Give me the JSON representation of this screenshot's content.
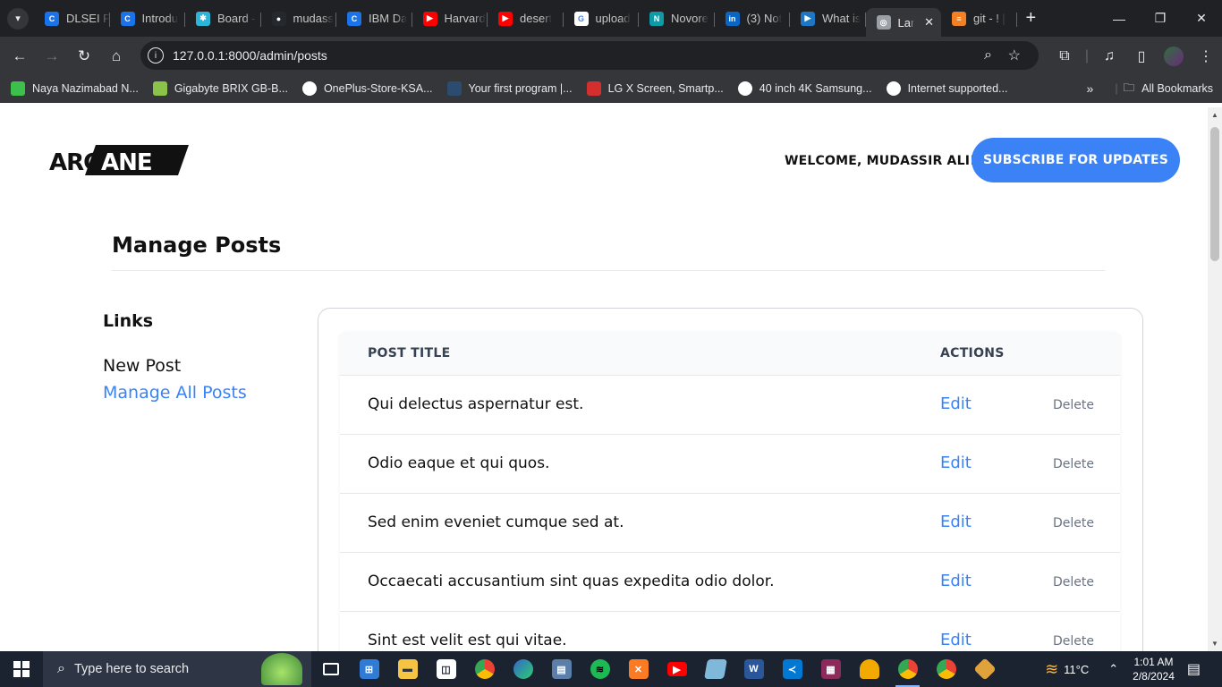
{
  "browser": {
    "tabs": [
      {
        "title": "DLSEI P",
        "color": "#1a73e8",
        "glyph": "C"
      },
      {
        "title": "Introdu",
        "color": "#1a73e8",
        "glyph": "C"
      },
      {
        "title": "Board -",
        "color": "#2bb5d8",
        "glyph": "✱"
      },
      {
        "title": "mudass",
        "color": "#24292e",
        "glyph": "●"
      },
      {
        "title": "IBM Da",
        "color": "#1a73e8",
        "glyph": "C"
      },
      {
        "title": "Harvard",
        "color": "#ff0000",
        "glyph": "▶"
      },
      {
        "title": "desert",
        "color": "#ff0000",
        "glyph": "▶"
      },
      {
        "title": "upload",
        "color": "#ffffff",
        "glyph": "G"
      },
      {
        "title": "Novore",
        "color": "#0f9aa8",
        "glyph": "N"
      },
      {
        "title": "(3) Not",
        "color": "#0a66c2",
        "glyph": "in"
      },
      {
        "title": "What is",
        "color": "#1d77c2",
        "glyph": "▶"
      },
      {
        "title": "Lar",
        "color": "#9aa0a6",
        "glyph": "◎",
        "active": true
      },
      {
        "title": "git - ! [",
        "color": "#f48024",
        "glyph": "≡"
      }
    ],
    "url": "127.0.0.1:8000/admin/posts",
    "bookmarks": [
      {
        "label": "Naya Nazimabad N...",
        "color": "#3dbf4b"
      },
      {
        "label": "Gigabyte BRIX GB-B...",
        "color": "#8bc34a"
      },
      {
        "label": "OnePlus-Store-KSA...",
        "color": "#ffffff"
      },
      {
        "label": "Your first program |...",
        "color": "#2b4b6f"
      },
      {
        "label": "LG X Screen, Smartp...",
        "color": "#d32f2f"
      },
      {
        "label": "40 inch 4K Samsung...",
        "color": "#ffffff"
      },
      {
        "label": "Internet supported...",
        "color": "#ffffff"
      }
    ],
    "all_bookmarks": "All Bookmarks"
  },
  "site": {
    "logo_text": "ARCANE",
    "welcome": "WELCOME, MUDASSIR ALI!",
    "subscribe_label": "SUBSCRIBE FOR UPDATES",
    "page_title": "Manage Posts",
    "links_heading": "Links",
    "links": {
      "new_post": "New Post",
      "manage_all": "Manage All Posts"
    },
    "table": {
      "col_title": "POST TITLE",
      "col_actions": "ACTIONS",
      "edit_label": "Edit",
      "delete_label": "Delete",
      "rows": [
        "Qui delectus aspernatur est.",
        "Odio eaque et qui quos.",
        "Sed enim eveniet cumque sed at.",
        "Occaecati accusantium sint quas expedita odio dolor.",
        "Sint est velit est qui vitae."
      ]
    }
  },
  "taskbar": {
    "search_placeholder": "Type here to search",
    "weather": "11°C",
    "time": "1:01 AM",
    "date": "2/8/2024"
  }
}
